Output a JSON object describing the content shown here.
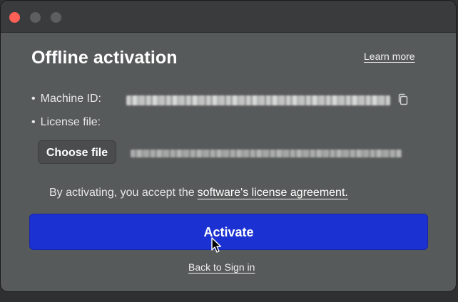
{
  "window": {
    "traffic_lights": {
      "close_color": "#fe5f57",
      "inactive_color": "#5d5e60"
    }
  },
  "header": {
    "title": "Offline activation",
    "learn_more": "Learn more"
  },
  "machine_id": {
    "bullet": "•",
    "label": "Machine ID:",
    "value_state": "redacted/blurred",
    "copy_icon": "copy-icon"
  },
  "license_file": {
    "bullet": "•",
    "label": "License file:",
    "choose_button": "Choose file",
    "path_state": "redacted/blurred"
  },
  "agreement": {
    "prefix": "By activating, you accept the",
    "link": "software's license agreement."
  },
  "actions": {
    "activate": "Activate",
    "back": "Back to Sign in"
  },
  "colors": {
    "background": "#575a5a",
    "titlebar": "#3a3b3c",
    "accent": "#1b31d1"
  },
  "pointer": "arrow-cursor"
}
